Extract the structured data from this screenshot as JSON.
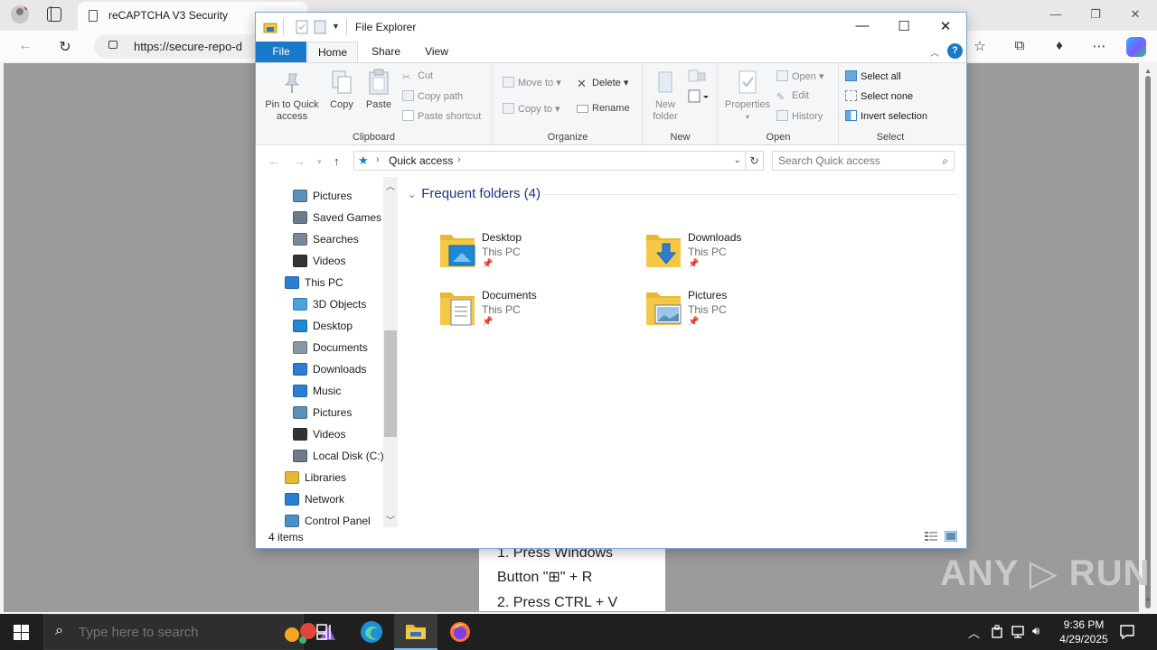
{
  "browser": {
    "tab_title": "reCAPTCHA V3 Security",
    "url": "https://secure-repo-d",
    "window_controls": {
      "minimize": "—",
      "restore": "❐",
      "close": "✕"
    },
    "nav": {
      "back": "←",
      "refresh": "↻"
    },
    "toolbar_icons": {
      "favorites": "☆",
      "favorites_bar": "☆",
      "collections": "⧉",
      "extensions": "♦",
      "menu": "⋯"
    }
  },
  "page": {
    "instructions": [
      "1. Press Windows",
      "Button \"⊞\" + R",
      "2. Press CTRL + V"
    ],
    "watermark": "ANY ▷ RUN"
  },
  "explorer": {
    "title": "File Explorer",
    "window_controls": {
      "minimize": "—",
      "maximize": "☐",
      "close": "✕"
    },
    "ribbon_tabs": [
      "File",
      "Home",
      "Share",
      "View"
    ],
    "ribbon": {
      "clipboard": {
        "label": "Clipboard",
        "pin": "Pin to Quick access",
        "pin_l1": "Pin to Quick",
        "pin_l2": "access",
        "copy": "Copy",
        "paste": "Paste",
        "cut": "Cut",
        "copy_path": "Copy path",
        "paste_shortcut": "Paste shortcut"
      },
      "organize": {
        "label": "Organize",
        "move_to": "Move to",
        "copy_to": "Copy to",
        "delete": "Delete",
        "rename": "Rename"
      },
      "new": {
        "label": "New",
        "new_folder_l1": "New",
        "new_folder_l2": "folder"
      },
      "open": {
        "label": "Open",
        "properties": "Properties",
        "open": "Open",
        "edit": "Edit",
        "history": "History"
      },
      "select": {
        "label": "Select",
        "select_all": "Select all",
        "select_none": "Select none",
        "invert": "Invert selection"
      }
    },
    "address": {
      "location": "Quick access",
      "search_placeholder": "Search Quick access"
    },
    "nav_pane": [
      {
        "label": "Pictures",
        "indent": 1,
        "icon": "pictures-icon"
      },
      {
        "label": "Saved Games",
        "indent": 1,
        "icon": "saved-games-icon"
      },
      {
        "label": "Searches",
        "indent": 1,
        "icon": "searches-icon"
      },
      {
        "label": "Videos",
        "indent": 1,
        "icon": "videos-icon"
      },
      {
        "label": "This PC",
        "indent": 0,
        "icon": "this-pc-icon"
      },
      {
        "label": "3D Objects",
        "indent": 1,
        "icon": "3d-objects-icon"
      },
      {
        "label": "Desktop",
        "indent": 1,
        "icon": "desktop-icon"
      },
      {
        "label": "Documents",
        "indent": 1,
        "icon": "documents-icon"
      },
      {
        "label": "Downloads",
        "indent": 1,
        "icon": "downloads-icon"
      },
      {
        "label": "Music",
        "indent": 1,
        "icon": "music-icon"
      },
      {
        "label": "Pictures",
        "indent": 1,
        "icon": "pictures-icon"
      },
      {
        "label": "Videos",
        "indent": 1,
        "icon": "videos-icon"
      },
      {
        "label": "Local Disk (C:)",
        "indent": 1,
        "icon": "local-disk-icon"
      },
      {
        "label": "Libraries",
        "indent": 0,
        "icon": "libraries-icon"
      },
      {
        "label": "Network",
        "indent": 0,
        "icon": "network-icon"
      },
      {
        "label": "Control Panel",
        "indent": 0,
        "icon": "control-panel-icon"
      }
    ],
    "section": {
      "title": "Frequent folders (4)"
    },
    "folders": [
      {
        "name": "Desktop",
        "location": "This PC",
        "icon": "desktop-folder-icon"
      },
      {
        "name": "Downloads",
        "location": "This PC",
        "icon": "downloads-folder-icon"
      },
      {
        "name": "Documents",
        "location": "This PC",
        "icon": "documents-folder-icon"
      },
      {
        "name": "Pictures",
        "location": "This PC",
        "icon": "pictures-folder-icon"
      }
    ],
    "status": {
      "item_count": "4 items"
    }
  },
  "taskbar": {
    "search_placeholder": "Type here to search",
    "time": "9:36 PM",
    "date": "4/29/2025"
  },
  "colors": {
    "accent": "#1979ca",
    "taskbar_bg": "#1f1f1f",
    "section_header": "#1e3287",
    "folder_yellow": "#f5c747"
  }
}
